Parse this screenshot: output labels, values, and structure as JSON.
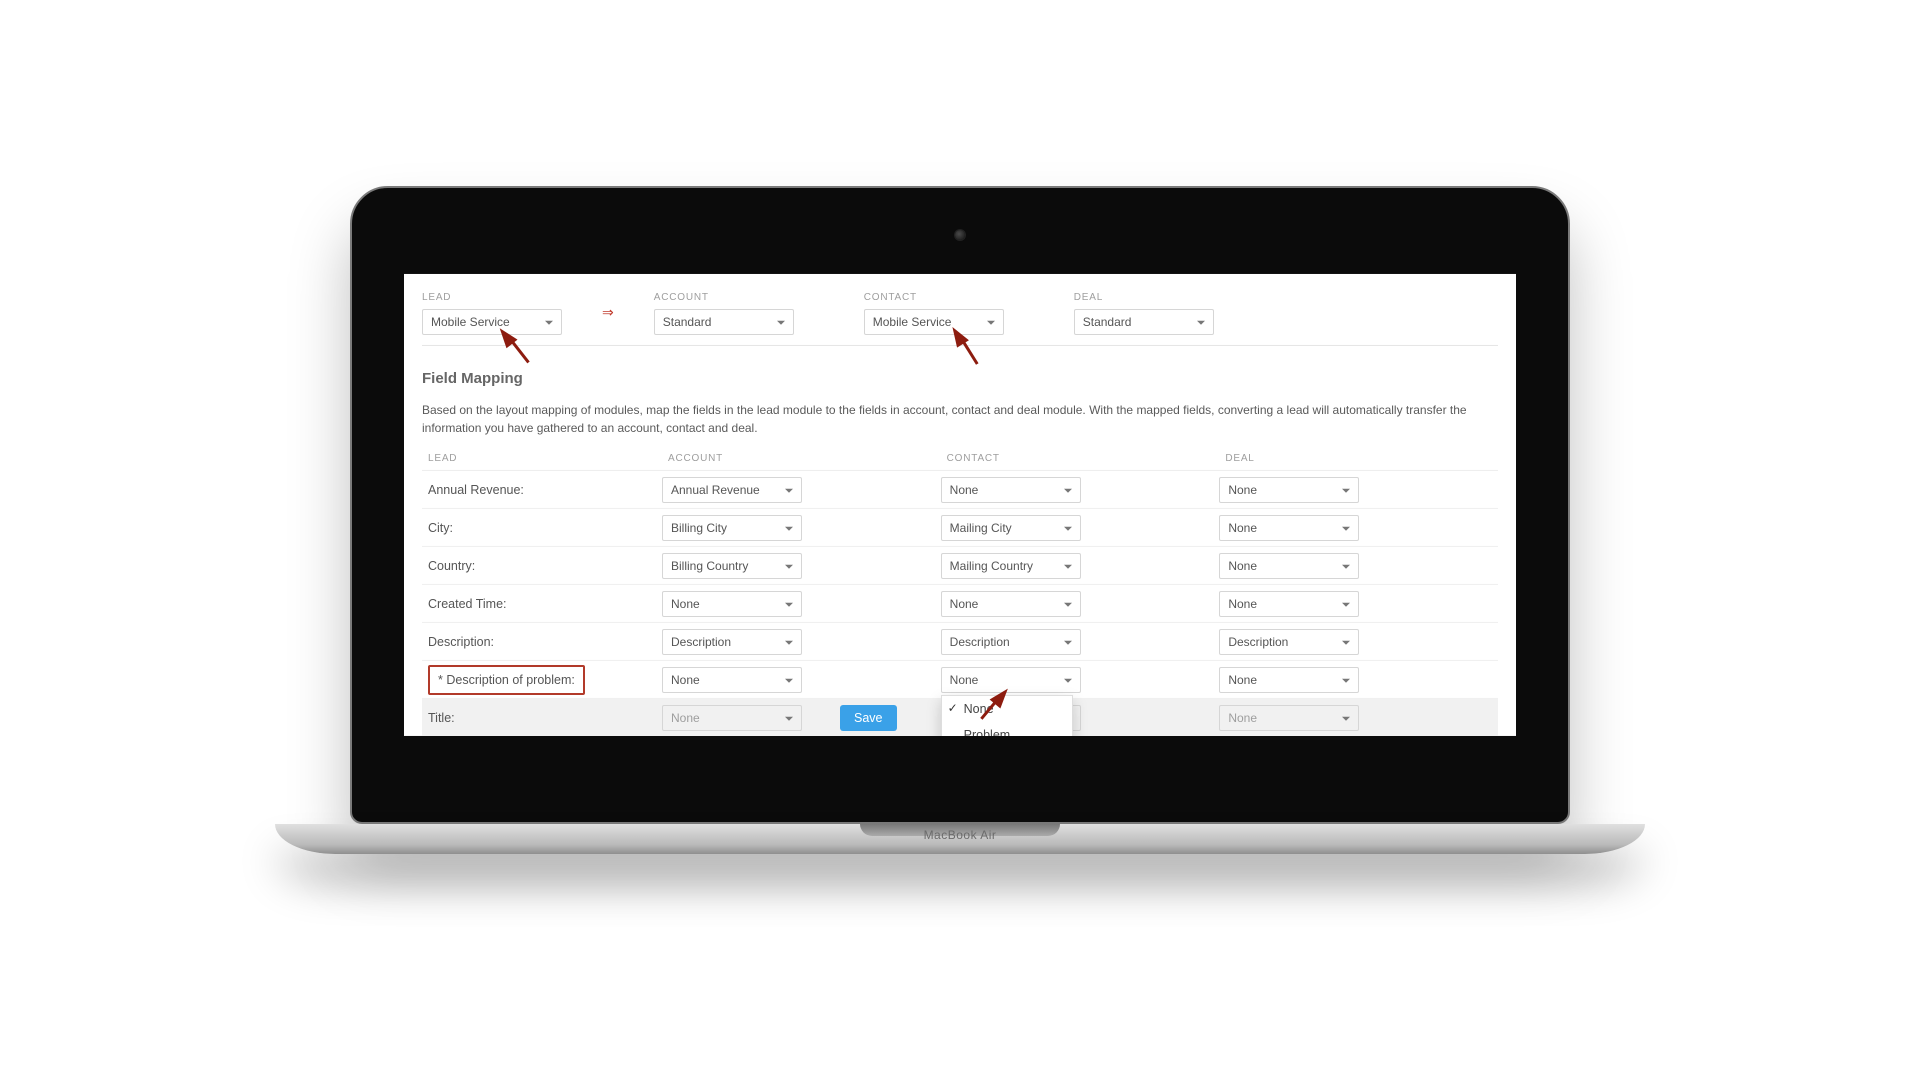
{
  "device": {
    "label": "MacBook Air"
  },
  "topbar": {
    "lead": {
      "label": "LEAD",
      "value": "Mobile Service"
    },
    "account": {
      "label": "ACCOUNT",
      "value": "Standard"
    },
    "contact": {
      "label": "CONTACT",
      "value": "Mobile Service"
    },
    "deal": {
      "label": "DEAL",
      "value": "Standard"
    },
    "maps_to_glyph": "⇒"
  },
  "section_title": "Field Mapping",
  "description": "Based on the layout mapping of modules, map the fields in the lead module to the fields in account, contact and deal module. With the mapped fields, converting a lead will automatically transfer the information you have gathered to an account, contact and deal.",
  "columns": {
    "lead": "LEAD",
    "account": "ACCOUNT",
    "contact": "CONTACT",
    "deal": "DEAL"
  },
  "rows": [
    {
      "name": "Annual Revenue:",
      "account": "Annual Revenue",
      "contact": "None",
      "deal": "None"
    },
    {
      "name": "City:",
      "account": "Billing City",
      "contact": "Mailing City",
      "deal": "None"
    },
    {
      "name": "Country:",
      "account": "Billing Country",
      "contact": "Mailing Country",
      "deal": "None"
    },
    {
      "name": "Created Time:",
      "account": "None",
      "contact": "None",
      "deal": "None"
    },
    {
      "name": "Description:",
      "account": "Description",
      "contact": "Description",
      "deal": "Description"
    },
    {
      "name": "* Description of problem:",
      "account": "None",
      "contact": "None",
      "deal": "None",
      "highlighted": true,
      "contact_open": true
    },
    {
      "name": "Title:",
      "account": "None",
      "contact": "",
      "deal": "None",
      "disabled": true
    }
  ],
  "dropdown": {
    "options": [
      "None",
      "Problem Description"
    ],
    "selected": "None"
  },
  "save_label": "Save"
}
